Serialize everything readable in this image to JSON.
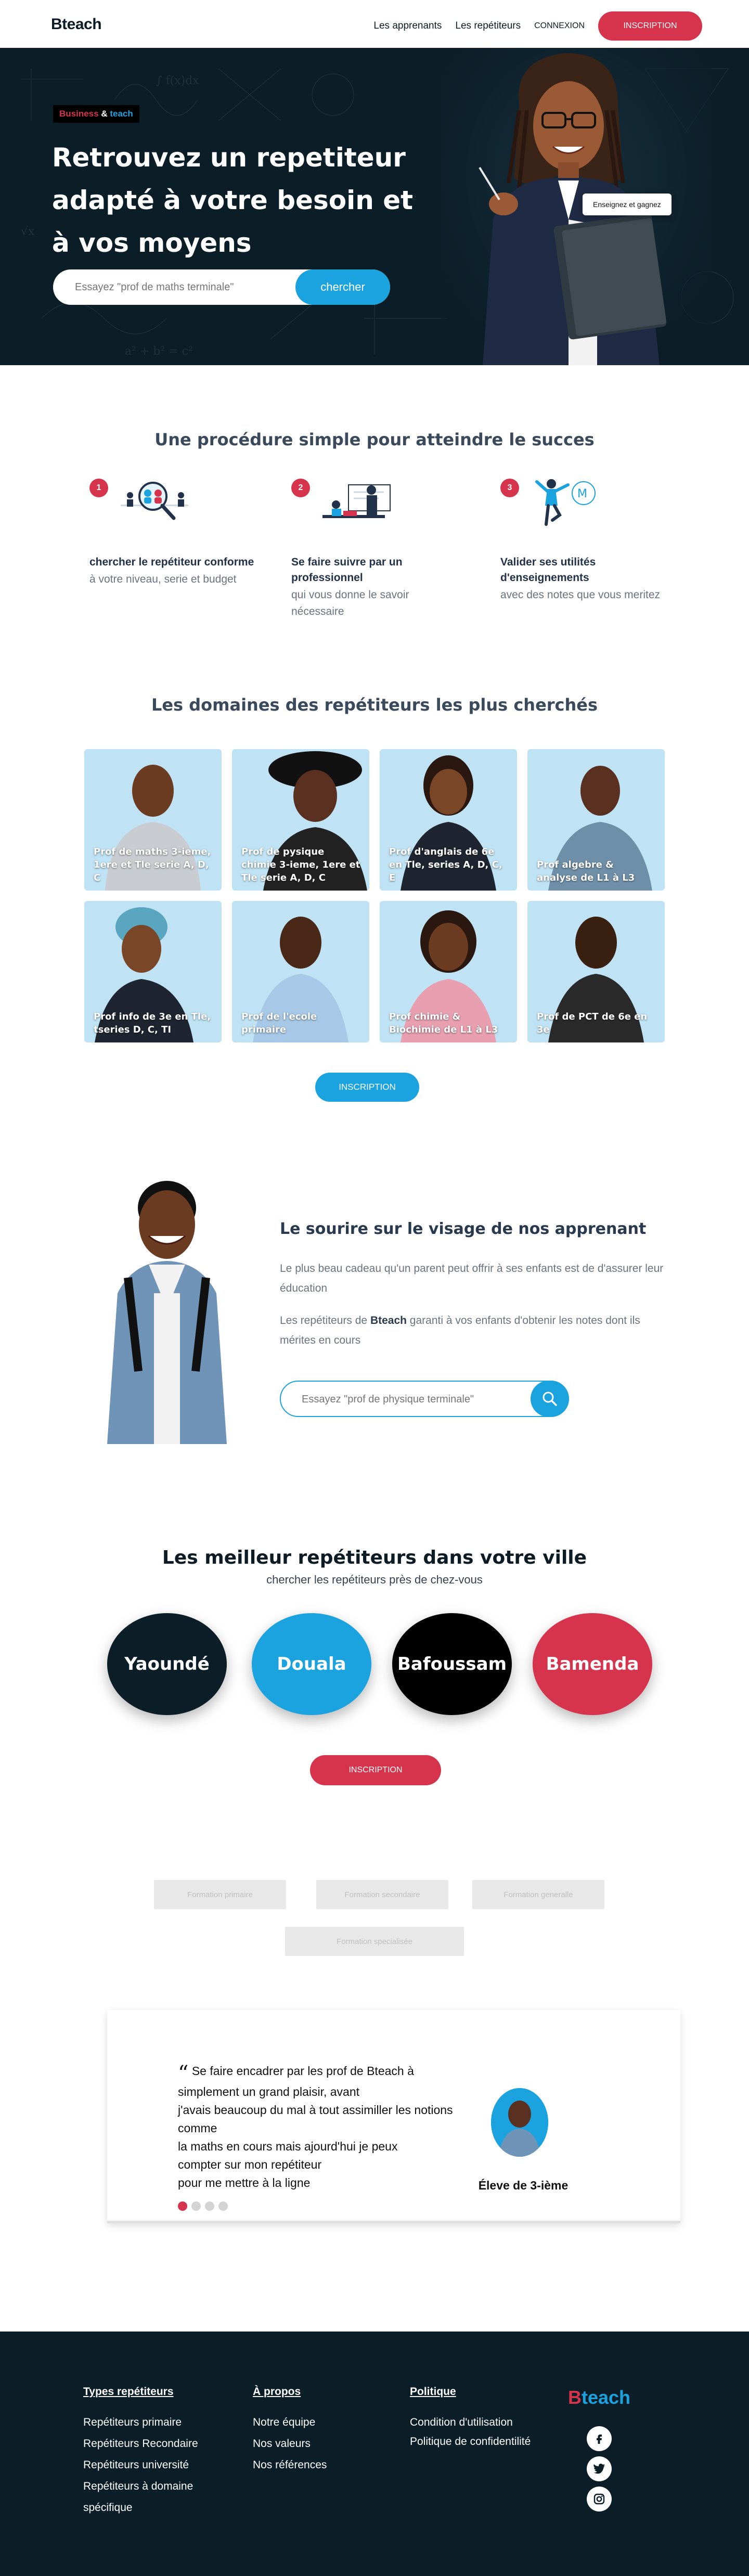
{
  "nav": {
    "logo": "Bteach",
    "links": [
      "Les apprenants",
      "Les repétiteurs"
    ],
    "connexion": "CONNEXION",
    "inscription": "INSCRIPTION"
  },
  "hero": {
    "badge_business": "Business",
    "badge_amp": "&",
    "badge_teach": "teach",
    "title": "Retrouvez un repetiteur adapté à votre besoin et à vos moyens",
    "search_placeholder": "Essayez \"prof de maths terminale\"",
    "search_button": "chercher",
    "tag": "Enseignez et gagnez"
  },
  "procedure": {
    "title": "Une procédure simple pour atteindre le succes",
    "steps": [
      {
        "num": "1",
        "head": "chercher le repétiteur conforme",
        "desc": "à votre niveau, serie et budget"
      },
      {
        "num": "2",
        "head": "Se faire suivre par un professionnel",
        "desc": "qui vous donne le savoir nécessaire"
      },
      {
        "num": "3",
        "head": "Valider ses utilités d'enseignements",
        "desc": "avec des notes que vous meritez"
      }
    ]
  },
  "domaines": {
    "title": "Les domaines des repétiteurs les plus cherchés",
    "cards": [
      "Prof de maths 3-ieme, 1ere et Tle serie A, D, C",
      "Prof de pysique chimie 3-ieme, 1ere et Tle serie A, D, C",
      "Prof d'anglais de 6e en Tle, series A, D, C, E",
      "Prof algebre & analyse de L1 à L3",
      "Prof info de 3e en Tle, tseries D, C, TI",
      "Prof de l'ecole primaire",
      "Prof chimie & Biochimie de L1 à L3",
      "Prof de PCT de 6e en 3e"
    ],
    "button": "INSCRIPTION"
  },
  "smile": {
    "title": "Le sourire sur le visage de nos apprenant",
    "p1": "Le plus beau cadeau qu'un parent peut offrir à ses enfants est de d'assurer leur éducation",
    "p2_before": "Les repétiteurs de ",
    "p2_brand": "Bteach",
    "p2_after": " garanti à vos enfants d'obtenir les notes dont ils mérites en cours",
    "search_placeholder": "Essayez \"prof de physique terminale\""
  },
  "cities": {
    "title": "Les meilleur repétiteurs dans votre ville",
    "subtitle": "chercher les repétiteurs près de chez-vous",
    "list": [
      {
        "name": "Yaoundé",
        "color": "#0b1d27"
      },
      {
        "name": "Douala",
        "color": "#1ba3e0"
      },
      {
        "name": "Bafoussam",
        "color": "#000000"
      },
      {
        "name": "Bamenda",
        "color": "#d6334d"
      }
    ],
    "button": "INSCRIPTION"
  },
  "tabs": [
    "Formation primaire",
    "Formation secondaire",
    "Formation generalle",
    "Formation specialisée"
  ],
  "testimonial": {
    "quote_mark": "“",
    "lines": [
      "Se faire encadrer par les prof de Bteach à",
      "simplement un grand plaisir, avant",
      "j'avais beaucoup du mal à tout assimiller les notions comme",
      "la maths en cours mais ajourd'hui je peux",
      "compter sur mon repétiteur",
      "pour me mettre à la ligne"
    ],
    "role": "Éleve de 3-ième",
    "active_slide": 1,
    "slides": 4
  },
  "footer": {
    "col1": {
      "title": "Types repétiteurs",
      "links": [
        "Repétiteurs primaire",
        "Repétiteurs Recondaire",
        "Repétiteurs université",
        "Repétiteurs à domaine spécifique"
      ]
    },
    "col2": {
      "title": "À propos",
      "links": [
        "Notre équipe",
        "Nos valeurs",
        "Nos références"
      ]
    },
    "col3": {
      "title": "Politique",
      "links": [
        "Condition d'utilisation",
        "Politique de confidentilité"
      ]
    },
    "logo_b": "B",
    "logo_rest": "teach",
    "social_icons": [
      "facebook-icon",
      "twitter-icon",
      "instagram-icon"
    ]
  },
  "colors": {
    "navy": "#0b1d27",
    "red": "#d6334d",
    "blue": "#1ba3e0"
  }
}
